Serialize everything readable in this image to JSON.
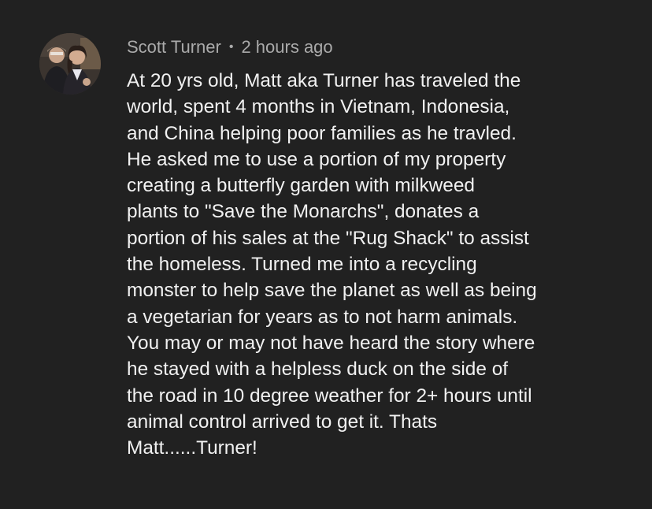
{
  "comment": {
    "author": "Scott Turner",
    "separator": "•",
    "timestamp": "2 hours ago",
    "avatar_icon": "user-avatar-photo",
    "text": "At 20 yrs old, Matt aka Turner has traveled the\nworld, spent 4 months in Vietnam, Indonesia,\nand China helping poor families as he travled.\nHe asked me to use a portion of my property\ncreating a butterfly garden with milkweed\nplants to \"Save the Monarchs\", donates a\nportion of his sales at the \"Rug Shack\" to assist\nthe homeless. Turned me into a recycling\nmonster to help save the planet as well as being\na vegetarian for years as to not harm animals.\nYou may or may not have heard the story where\nhe stayed with a helpless duck on the side of\nthe road in 10 degree weather for 2+ hours until\nanimal control arrived to get it. Thats\nMatt......Turner!"
  },
  "colors": {
    "background": "#212121",
    "meta_text": "#aaaaaa",
    "body_text": "#f1f1f1"
  }
}
